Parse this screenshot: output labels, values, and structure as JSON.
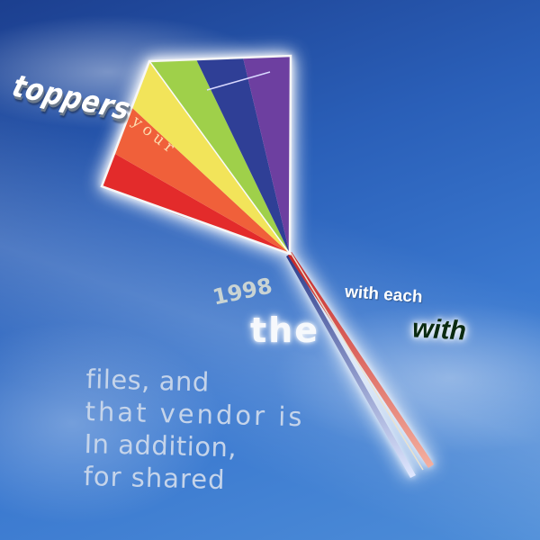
{
  "scene": {
    "subject": "rainbow-kite",
    "colors": {
      "sky_dark": "#1c3f8f",
      "sky_light": "#4d8dd8",
      "kite_red": "#e32b2b",
      "kite_orange": "#f0603a",
      "kite_yellow": "#f2e45a",
      "kite_green": "#9fd04a",
      "kite_blue": "#2f3f96",
      "kite_purple": "#6d3fa0"
    }
  },
  "words": {
    "toppers": "toppers",
    "your": "your",
    "year": "1998",
    "the": "the",
    "with_each": "with each",
    "with": "with"
  },
  "paragraph": {
    "lines": [
      "files, and",
      "that vendor is",
      "In addition,",
      "for shared"
    ]
  }
}
